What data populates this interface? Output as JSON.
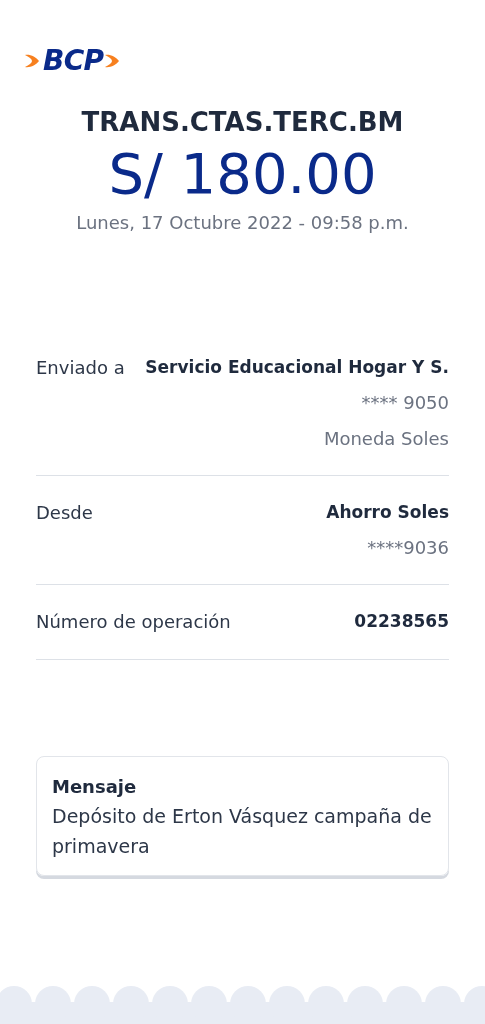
{
  "logo": {
    "text": "BCP"
  },
  "header": {
    "title": "TRANS.CTAS.TERC.BM",
    "amount": "S/ 180.00",
    "datetime": "Lunes, 17 Octubre 2022 - 09:58 p.m."
  },
  "details": [
    {
      "label": "Enviado a",
      "values": [
        {
          "kind": "primary",
          "text": "Servicio Educacional Hogar Y S."
        },
        {
          "kind": "secondary",
          "text": "**** 9050"
        },
        {
          "kind": "secondary",
          "text": "Moneda Soles"
        }
      ]
    },
    {
      "label": "Desde",
      "values": [
        {
          "kind": "primary",
          "text": "Ahorro Soles"
        },
        {
          "kind": "secondary",
          "text": "****9036"
        }
      ]
    },
    {
      "label": "Número de operación",
      "values": [
        {
          "kind": "primary",
          "text": "02238565"
        }
      ]
    }
  ],
  "message": {
    "title": "Mensaje",
    "text": "Depósito de Erton Vásquez campaña de primavera"
  }
}
